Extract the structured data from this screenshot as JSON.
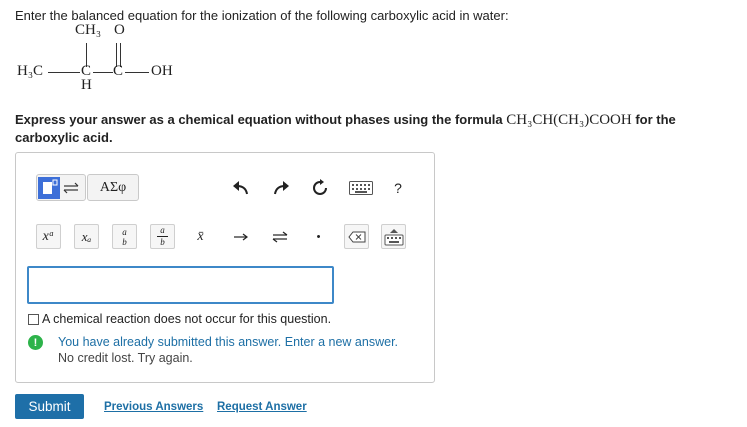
{
  "question": {
    "prompt": "Enter the balanced equation for the ionization of the following carboxylic acid in water:",
    "structure": {
      "ch3_top": "CH₃",
      "o_top": "O",
      "h3c": "H₃C",
      "c1": "C",
      "c2": "C",
      "oh": "OH",
      "h_bottom": "H"
    },
    "express_before": "Express your answer as a chemical equation without phases using the formula ",
    "formula": "CH₃CH(CH₃)COOH",
    "express_after": " for the carboxylic acid."
  },
  "toolbar": {
    "greek_label": "ΑΣφ",
    "help_label": "?",
    "superscript_label": "xᵃ",
    "subscript_label": "xₐ",
    "fraction_small_top": "a",
    "fraction_small_bottom": "b",
    "fraction_box_top": "a",
    "fraction_box_bottom": "b",
    "bar_label": "x̄",
    "dot_label": "•"
  },
  "answer": {
    "value": "",
    "no_reaction_label": "A chemical reaction does not occur for this question."
  },
  "feedback": {
    "icon": "!",
    "line1": "You have already submitted this answer. Enter a new answer.",
    "line2": "No credit lost. Try again."
  },
  "actions": {
    "submit": "Submit",
    "previous_answers": "Previous Answers",
    "request_answer": "Request Answer"
  },
  "colors": {
    "accent": "#1e6fa8",
    "input_border": "#3d88c8",
    "template_button": "#3d6fd8",
    "alert_green": "#2db34a"
  }
}
